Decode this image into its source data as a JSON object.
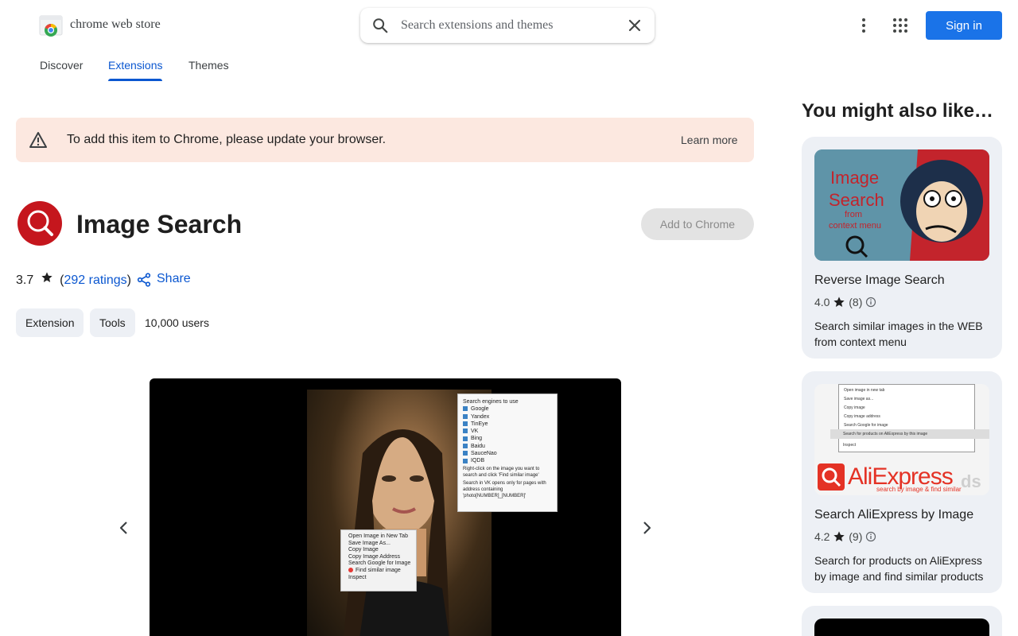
{
  "header": {
    "logo_text": "chrome web store",
    "search_placeholder": "Search extensions and themes",
    "signin_label": "Sign in"
  },
  "tabs": [
    {
      "label": "Discover",
      "active": false
    },
    {
      "label": "Extensions",
      "active": true
    },
    {
      "label": "Themes",
      "active": false
    }
  ],
  "banner": {
    "message": "To add this item to Chrome, please update your browser.",
    "link": "Learn more"
  },
  "item": {
    "title": "Image Search",
    "add_label": "Add to Chrome",
    "rating": "3.7",
    "ratings_count": "292 ratings",
    "share_label": "Share",
    "chips": [
      "Extension",
      "Tools"
    ],
    "users": "10,000 users"
  },
  "screenshot": {
    "panel_title": "Search engines to use",
    "engines": [
      "Google",
      "Yandex",
      "TinEye",
      "VK",
      "Bing",
      "Baidu",
      "SauceNao",
      "IQDB"
    ],
    "panel_note_1": "Right-click on the image you want to search and click 'Find similar image'",
    "panel_note_2": "Search in VK opens only for pages with address containing 'photo[NUMBER]_[NUMBER]'",
    "context_menu": [
      "Open Image in New Tab",
      "Save Image As...",
      "Copy Image",
      "Copy Image Address",
      "Search Google for Image"
    ],
    "context_highlight": "Find similar image",
    "context_last": "Inspect"
  },
  "sidebar": {
    "title": "You might also like…",
    "cards": [
      {
        "name": "Reverse Image Search",
        "rating": "4.0",
        "count": "(8)",
        "description": "Search similar images in the WEB from context menu",
        "thumb_text_1": "Image",
        "thumb_text_2": "Search",
        "thumb_text_3": "from",
        "thumb_text_4": "context menu"
      },
      {
        "name": "Search AliExpress by Image",
        "rating": "4.2",
        "count": "(9)",
        "description": "Search for products on AliExpress by image and find similar products",
        "thumb_menu": [
          "Open image in new tab",
          "Save image as...",
          "Copy image",
          "Copy image address",
          "Search Google for image"
        ],
        "thumb_highlight": "Search for products on AliExpress by this image",
        "thumb_inspect": "Inspect",
        "thumb_logo": "AliExpress",
        "thumb_tagline": "search by image & find similar",
        "thumb_ds": "ds"
      }
    ]
  },
  "colors": {
    "accent": "#0b57d0",
    "signin_bg": "#1a73e8",
    "banner_bg": "#fce8e0",
    "card_bg": "#edf0f5",
    "item_icon": "#c5161d"
  }
}
